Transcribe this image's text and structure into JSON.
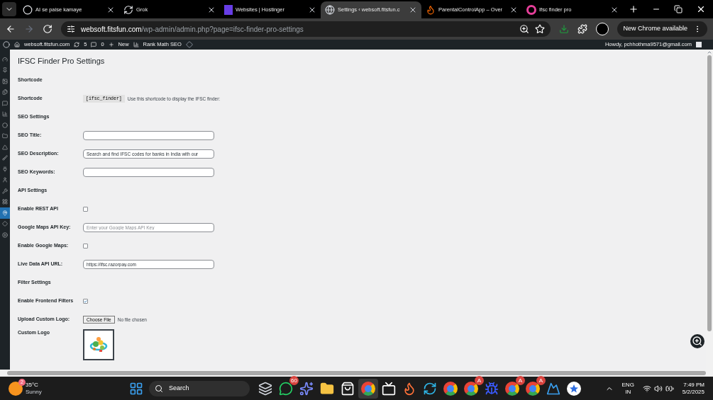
{
  "browser": {
    "tabs": [
      {
        "title": "AI se paise kamaye",
        "selected": false
      },
      {
        "title": "Grok",
        "selected": false
      },
      {
        "title": "Websites | Hostinger",
        "selected": false
      },
      {
        "title": "Settings ‹ websoft.fitsfun.c",
        "selected": true
      },
      {
        "title": "ParentalControlApp – Over",
        "selected": false
      },
      {
        "title": "Ifsc finder pro",
        "selected": false
      }
    ],
    "address": {
      "domain": "websoft.fitsfun.com",
      "path": "/wp-admin/admin.php?page=ifsc-finder-pro-settings"
    },
    "update_button": "New Chrome available"
  },
  "admin_bar": {
    "site": "websoft.fitsfun.com",
    "updates": "5",
    "comments": "0",
    "new": "New",
    "seo": "Rank Math SEO",
    "greeting": "Howdy, pchhothma9571@gmail.com"
  },
  "sidebar": {
    "items": [
      {
        "selected": false
      },
      {
        "selected": false
      },
      {
        "selected": false
      },
      {
        "selected": false
      },
      {
        "selected": false
      },
      {
        "selected": false
      },
      {
        "selected": false
      },
      {
        "selected": false
      },
      {
        "selected": false
      },
      {
        "selected": false
      },
      {
        "selected": false
      },
      {
        "selected": false
      },
      {
        "selected": false
      },
      {
        "selected": false
      },
      {
        "selected": true
      },
      {
        "selected": false
      },
      {
        "selected": false
      }
    ]
  },
  "page": {
    "title": "IFSC Finder Pro Settings",
    "rows": [
      {
        "kind": "heading",
        "label": "Shortcode"
      },
      {
        "kind": "shortcode",
        "label": "Shortcode",
        "code": "[ifsc_finder]",
        "note": "Use this shortcode to display the IFSC finder:"
      },
      {
        "kind": "heading",
        "label": "SEO Settings"
      },
      {
        "kind": "text",
        "label": "SEO Title:"
      },
      {
        "kind": "text",
        "label": "SEO Description:",
        "value": "Search and find IFSC codes for banks in India with our"
      },
      {
        "kind": "text",
        "label": "SEO Keywords:"
      },
      {
        "kind": "heading",
        "label": "API Settings"
      },
      {
        "kind": "checkbox",
        "label": "Enable REST API",
        "checked": false
      },
      {
        "kind": "text",
        "label": "Google Maps API Key:",
        "placeholder": "Enter your Google Maps API Key"
      },
      {
        "kind": "checkbox",
        "label": "Enable Google Maps:",
        "checked": false
      },
      {
        "kind": "text",
        "label": "Live Data API URL:",
        "value": "https://ifsc.razorpay.com"
      },
      {
        "kind": "heading",
        "label": "Filter Settings"
      },
      {
        "kind": "checkbox",
        "label": "Enable Frontend Filters",
        "checked": true
      },
      {
        "kind": "file",
        "label": "Upload Custom Logo:",
        "button": "Choose File",
        "status": "No file chosen"
      },
      {
        "kind": "logo",
        "label": "Custom Logo"
      }
    ]
  },
  "taskbar": {
    "weather": {
      "badge": "2",
      "temp": "35°C",
      "condition": "Sunny"
    },
    "search": "Search",
    "apps": [
      {
        "kind": "stack"
      },
      {
        "kind": "chat",
        "badge": "60"
      },
      {
        "kind": "copilot"
      },
      {
        "kind": "folder"
      },
      {
        "kind": "store"
      },
      {
        "kind": "chrome",
        "selected": true
      },
      {
        "kind": "tv"
      },
      {
        "kind": "firefox"
      },
      {
        "kind": "edge"
      },
      {
        "kind": "chrome"
      },
      {
        "kind": "chrome",
        "badge": "A"
      },
      {
        "kind": "bug"
      },
      {
        "kind": "chrome",
        "badge": "A"
      },
      {
        "kind": "chrome",
        "badge": "A"
      },
      {
        "kind": "photos"
      },
      {
        "kind": "star"
      }
    ],
    "lang": "ENG",
    "region": "IN",
    "time": "7:49 PM",
    "date": "5/2/2025"
  }
}
